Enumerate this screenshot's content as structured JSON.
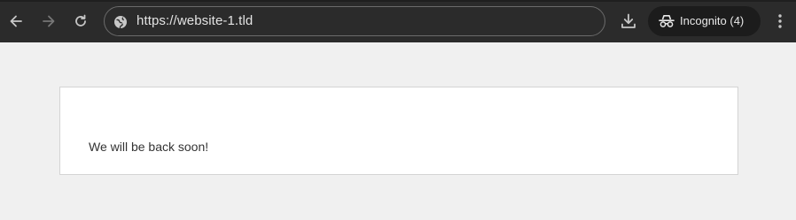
{
  "browser": {
    "url": "https://website-1.tld",
    "incognito_label": "Incognito (4)",
    "icons": {
      "back": "arrow-left-icon",
      "forward": "arrow-right-icon",
      "reload": "reload-icon",
      "site_info": "globe-icon",
      "download": "download-icon",
      "incognito": "incognito-icon",
      "menu": "vertical-dots-icon"
    },
    "colors": {
      "toolbar": "#2b2b2b",
      "chip": "#1c1c1c",
      "text": "#e3e3e3"
    }
  },
  "page": {
    "message": "We will be back soon!",
    "colors": {
      "background": "#f0f0f0",
      "card": "#ffffff",
      "text": "#333333"
    }
  }
}
